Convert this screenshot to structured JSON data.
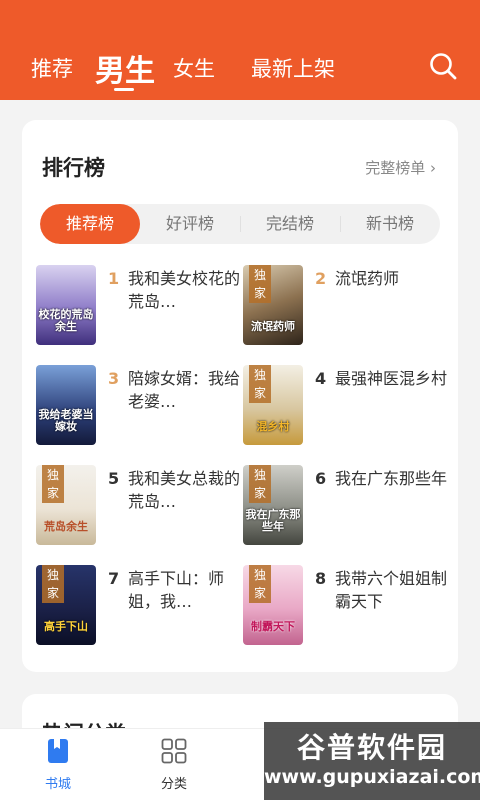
{
  "header": {
    "tabs": [
      "推荐",
      "男生",
      "女生",
      "最新上架"
    ],
    "active_tab": "男生",
    "search_icon": "search-icon"
  },
  "ranking": {
    "title": "排行榜",
    "full_list": "完整榜单",
    "full_list_arrow": "›",
    "segments": [
      "推荐榜",
      "好评榜",
      "完结榜",
      "新书榜"
    ],
    "active_segment": "推荐榜",
    "exclusive_badge": "独家",
    "books": [
      {
        "rank": "1",
        "title": "我和美女校花的荒岛…",
        "cover_text": "校花的荒岛余生",
        "exclusive": false
      },
      {
        "rank": "2",
        "title": "流氓药师",
        "cover_text": "流氓药师",
        "exclusive": true
      },
      {
        "rank": "3",
        "title": "陪嫁女婿：我给老婆…",
        "cover_text": "我给老婆当嫁妆",
        "exclusive": false
      },
      {
        "rank": "4",
        "title": "最强神医混乡村",
        "cover_text": "混乡村",
        "exclusive": true
      },
      {
        "rank": "5",
        "title": "我和美女总裁的荒岛…",
        "cover_text": "荒岛余生",
        "exclusive": true
      },
      {
        "rank": "6",
        "title": "我在广东那些年",
        "cover_text": "我在广东那些年",
        "exclusive": true
      },
      {
        "rank": "7",
        "title": "高手下山：师姐，我…",
        "cover_text": "高手下山",
        "exclusive": true
      },
      {
        "rank": "8",
        "title": "我带六个姐姐制霸天下",
        "cover_text": "制霸天下",
        "exclusive": true
      }
    ]
  },
  "section2": {
    "title": "热门分类"
  },
  "bottom_nav": [
    {
      "label": "书城",
      "icon": "bookmark-book-icon",
      "active": true
    },
    {
      "label": "分类",
      "icon": "grid-icon",
      "active": false
    }
  ],
  "watermark": {
    "cn": "谷普软件园",
    "en": "www.gupuxiazai.com"
  },
  "colors": {
    "accent": "#ee5a2a",
    "rank_top": "#e0a060",
    "rank_normal": "#333333",
    "nav_active": "#2f7bf0"
  }
}
